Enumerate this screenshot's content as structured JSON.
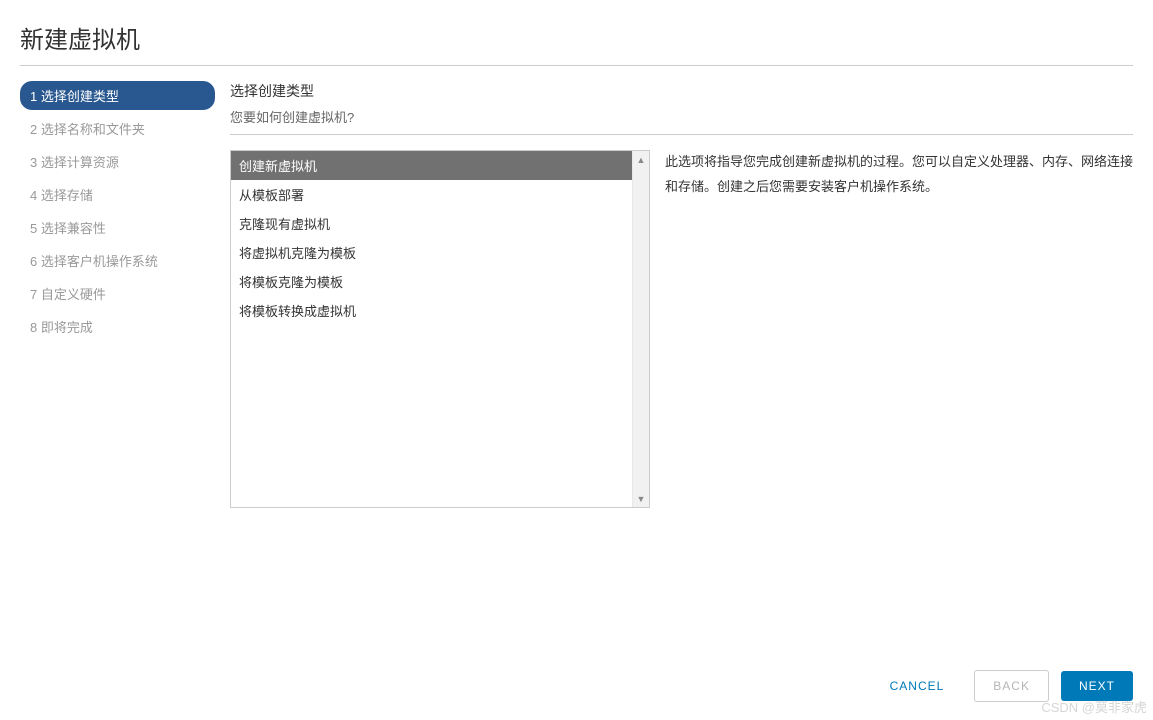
{
  "dialog": {
    "title": "新建虚拟机"
  },
  "sidebar": {
    "steps": [
      {
        "label": "1 选择创建类型",
        "active": true
      },
      {
        "label": "2 选择名称和文件夹",
        "active": false
      },
      {
        "label": "3 选择计算资源",
        "active": false
      },
      {
        "label": "4 选择存储",
        "active": false
      },
      {
        "label": "5 选择兼容性",
        "active": false
      },
      {
        "label": "6 选择客户机操作系统",
        "active": false
      },
      {
        "label": "7 自定义硬件",
        "active": false
      },
      {
        "label": "8 即将完成",
        "active": false
      }
    ]
  },
  "content": {
    "title": "选择创建类型",
    "subtitle": "您要如何创建虚拟机?",
    "options": [
      {
        "label": "创建新虚拟机",
        "selected": true
      },
      {
        "label": "从模板部署",
        "selected": false
      },
      {
        "label": "克隆现有虚拟机",
        "selected": false
      },
      {
        "label": "将虚拟机克隆为模板",
        "selected": false
      },
      {
        "label": "将模板克隆为模板",
        "selected": false
      },
      {
        "label": "将模板转换成虚拟机",
        "selected": false
      }
    ],
    "description": "此选项将指导您完成创建新虚拟机的过程。您可以自定义处理器、内存、网络连接和存储。创建之后您需要安装客户机操作系统。"
  },
  "footer": {
    "cancel_label": "CANCEL",
    "back_label": "BACK",
    "next_label": "NEXT"
  },
  "watermark": "CSDN @莫非家虎"
}
